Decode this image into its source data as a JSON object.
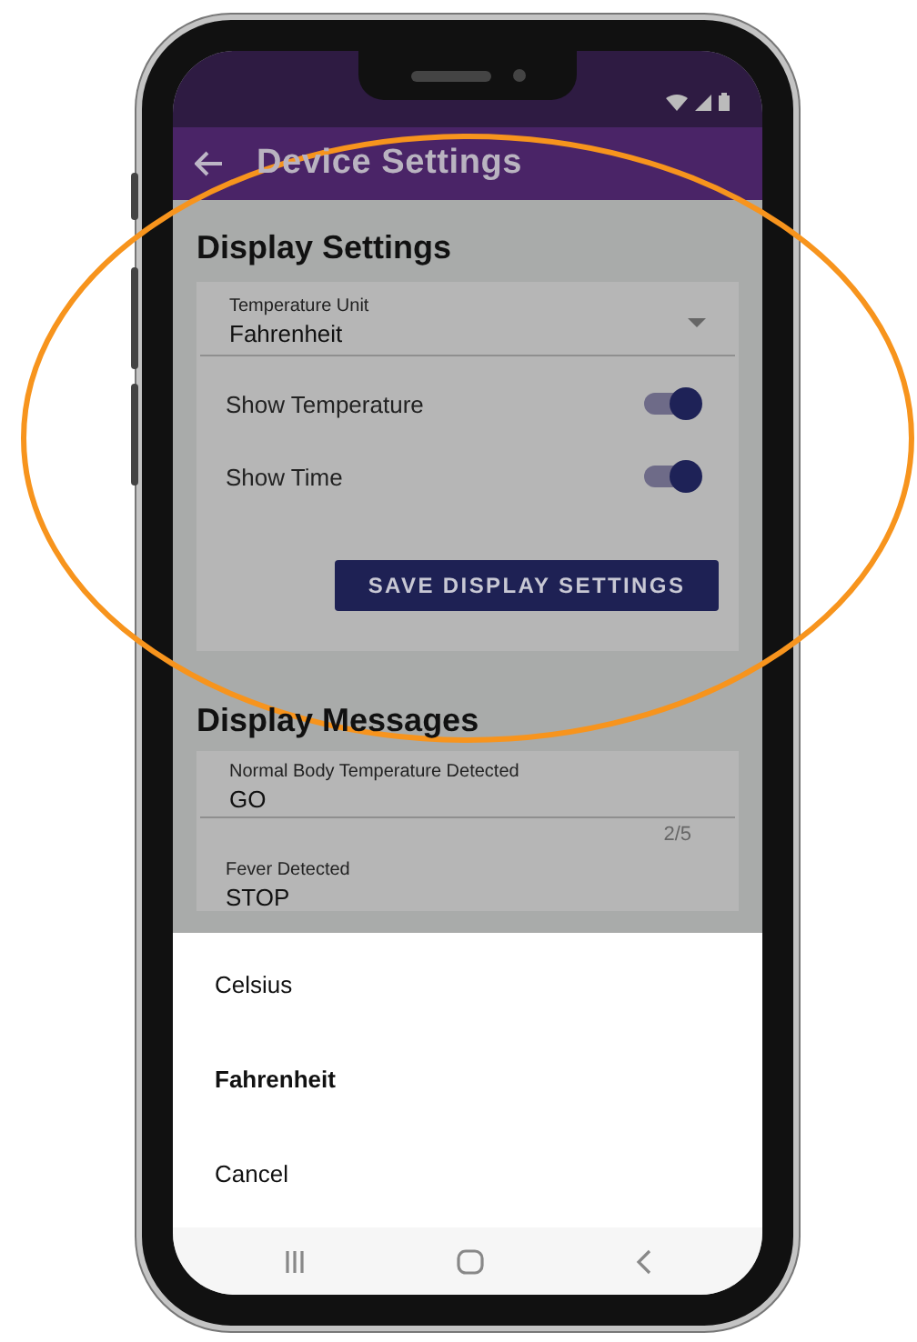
{
  "app_bar": {
    "title": "Device Settings"
  },
  "display_settings": {
    "heading": "Display Settings",
    "temperature_unit": {
      "label": "Temperature Unit",
      "value": "Fahrenheit"
    },
    "toggles": [
      {
        "label": "Show Temperature",
        "on": true
      },
      {
        "label": "Show Time",
        "on": true
      }
    ],
    "save_button": "SAVE DISPLAY SETTINGS"
  },
  "display_messages": {
    "heading": "Display Messages",
    "fields": [
      {
        "label": "Normal Body Temperature Detected",
        "value": "GO",
        "counter": "2/5"
      },
      {
        "label": "Fever Detected",
        "value": "STOP"
      }
    ]
  },
  "bottom_sheet": {
    "options": [
      {
        "label": "Celsius",
        "selected": false
      },
      {
        "label": "Fahrenheit",
        "selected": true
      },
      {
        "label": "Cancel",
        "selected": false
      }
    ]
  }
}
